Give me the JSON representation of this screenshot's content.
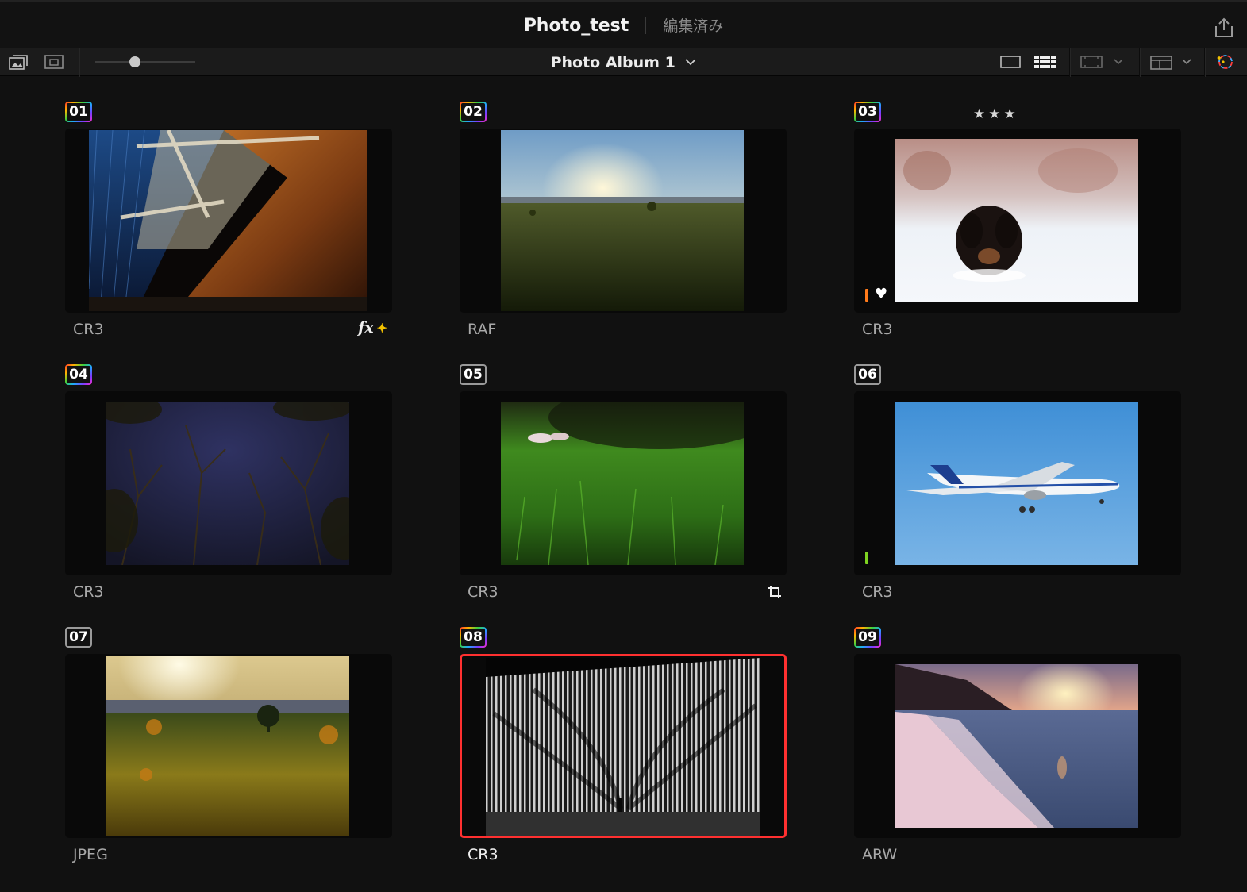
{
  "header": {
    "project_name": "Photo_test",
    "status": "編集済み"
  },
  "toolbar": {
    "album_name": "Photo Album 1",
    "thumbnail_size_level": 0.4
  },
  "colors": {
    "selection": "#ff3030",
    "flag_orange": "#ff7a1a",
    "flag_green": "#7ed321",
    "sparkle": "#f3c200"
  },
  "photos": [
    {
      "number": "01",
      "format": "CR3",
      "badge": "rainbow",
      "extras": [
        "fx-icon",
        "sparkle-icon"
      ],
      "fx_label": "fx",
      "spark": "✦"
    },
    {
      "number": "02",
      "format": "RAF",
      "badge": "rainbow"
    },
    {
      "number": "03",
      "format": "CR3",
      "badge": "rainbow",
      "rating": "★★★",
      "rating_value": 3,
      "flag": "orange",
      "favorite_icon": "heart-icon",
      "heart": "♥"
    },
    {
      "number": "04",
      "format": "CR3",
      "badge": "rainbow"
    },
    {
      "number": "05",
      "format": "CR3",
      "badge": "plain",
      "extras": [
        "crop-icon"
      ]
    },
    {
      "number": "06",
      "format": "CR3",
      "badge": "plain",
      "flag": "green"
    },
    {
      "number": "07",
      "format": "JPEG",
      "badge": "plain"
    },
    {
      "number": "08",
      "format": "CR3",
      "badge": "rainbow",
      "selected": true
    },
    {
      "number": "09",
      "format": "ARW",
      "badge": "rainbow"
    }
  ]
}
